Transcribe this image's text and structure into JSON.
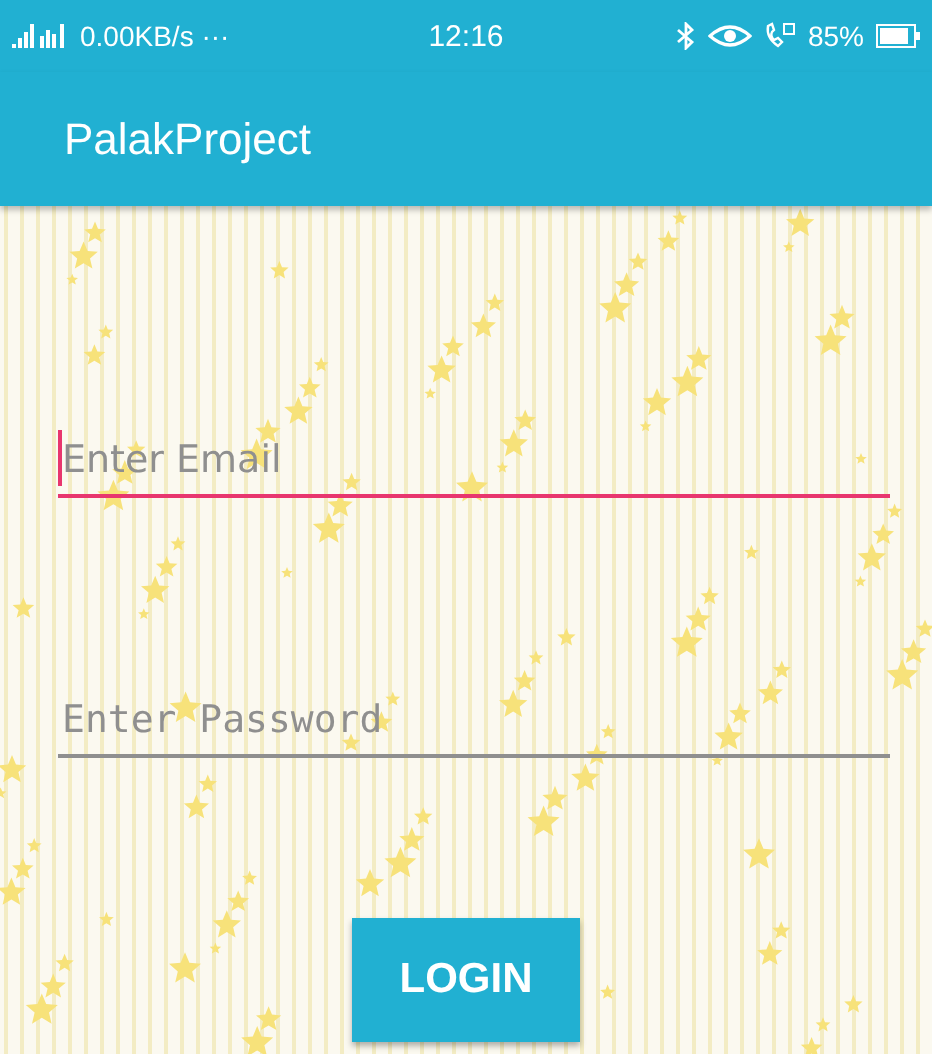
{
  "status_bar": {
    "network_speed": "0.00KB/s ···",
    "time": "12:16",
    "battery": "85%"
  },
  "app_bar": {
    "title": "PalakProject"
  },
  "fields": [
    {
      "kind": "email",
      "placeholder": "Enter Email",
      "focused": true
    },
    {
      "kind": "password",
      "placeholder": "Enter Password",
      "focused": false
    }
  ],
  "login_button": {
    "label": "LOGIN"
  }
}
